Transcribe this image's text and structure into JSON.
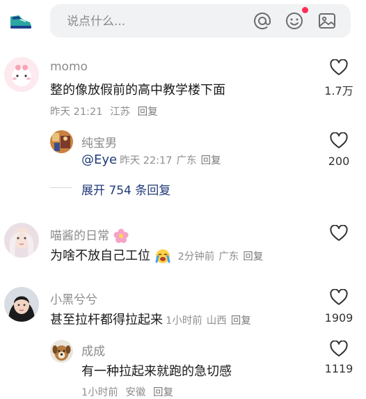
{
  "search": {
    "placeholder": "说点什么..."
  },
  "comments": [
    {
      "username": "momo",
      "text": "整的像放假前的高中教学楼下面",
      "time": "昨天 21:21",
      "location": "江苏",
      "reply_label": "回复",
      "likes": "1.7万",
      "sub": {
        "username": "纯宝男",
        "mention": "@Eye",
        "time": "昨天 22:17",
        "location": "广东",
        "reply_label": "回复",
        "likes": "200"
      },
      "expand_label": "展开 754 条回复"
    },
    {
      "username": "喵酱的日常",
      "text": "为啥不放自己工位",
      "time": "2分钟前",
      "location": "广东",
      "reply_label": "回复",
      "likes": ""
    },
    {
      "username": "小黑兮兮",
      "text": "甚至拉杆都得拉起来",
      "time": "1小时前",
      "location": "山西",
      "reply_label": "回复",
      "likes": "1909",
      "sub": {
        "username": "成成",
        "text": "有一种拉起来就跑的急切感",
        "time": "1小时前",
        "location": "安徽",
        "reply_label": "回复",
        "likes": "1119"
      }
    }
  ],
  "icons": {
    "top_left": "sneaker-icon",
    "mention": "at-icon",
    "emoji": "smiley-icon",
    "image": "image-icon",
    "like": "heart-outline-icon"
  },
  "colors": {
    "accent_blue": "#1f3a78",
    "notification_dot": "#ff2d55",
    "search_bg": "#f1f2f4"
  }
}
